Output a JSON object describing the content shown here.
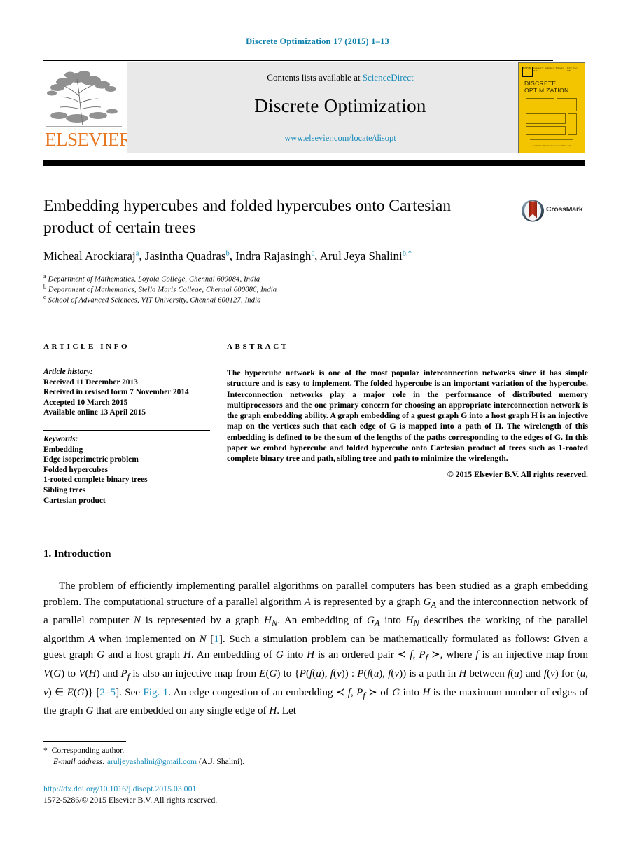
{
  "running_head": "Discrete Optimization 17 (2015) 1–13",
  "banner": {
    "publisher": "ELSEVIER",
    "contents_prefix": "Contents lists available at ",
    "contents_link": "ScienceDirect",
    "journal_name": "Discrete Optimization",
    "journal_url": "www.elsevier.com/locate/disopt",
    "cover": {
      "title_line1": "DISCRETE",
      "title_line2": "OPTIMIZATION",
      "top_left_mark": "ELSEVIER",
      "top_center_text": "Volume 17 · Number 1 · February 2015",
      "top_right_text": "ISSN 1572-5286",
      "footer_text": "Available online at www.sciencedirect.com"
    }
  },
  "article": {
    "title": "Embedding hypercubes and folded hypercubes onto Cartesian product of certain trees",
    "crossmark_label": "CrossMark",
    "authors_html": "Micheal Arockiaraj<sup>a</sup>, Jasintha Quadras<sup>b</sup>, Indra Rajasingh<sup>c</sup>, Arul Jeya Shalini<sup>b,*</sup>",
    "affiliations": [
      {
        "marker": "a",
        "text": "Department of Mathematics, Loyola College, Chennai 600084, India"
      },
      {
        "marker": "b",
        "text": "Department of Mathematics, Stella Maris College, Chennai 600086, India"
      },
      {
        "marker": "c",
        "text": "School of Advanced Sciences, VIT University, Chennai 600127, India"
      }
    ]
  },
  "info": {
    "heading": "ARTICLE INFO",
    "history_label": "Article history:",
    "history": [
      "Received 11 December 2013",
      "Received in revised form 7 November 2014",
      "Accepted 10 March 2015",
      "Available online 13 April 2015"
    ],
    "keywords_label": "Keywords:",
    "keywords": [
      "Embedding",
      "Edge isoperimetric problem",
      "Folded hypercubes",
      "1-rooted complete binary trees",
      "Sibling trees",
      "Cartesian product"
    ]
  },
  "abstract": {
    "heading": "ABSTRACT",
    "text": "The hypercube network is one of the most popular interconnection networks since it has simple structure and is easy to implement. The folded hypercube is an important variation of the hypercube. Interconnection networks play a major role in the performance of distributed memory multiprocessors and the one primary concern for choosing an appropriate interconnection network is the graph embedding ability. A graph embedding of a guest graph G into a host graph H is an injective map on the vertices such that each edge of G is mapped into a path of H. The wirelength of this embedding is defined to be the sum of the lengths of the paths corresponding to the edges of G. In this paper we embed hypercube and folded hypercube onto Cartesian product of trees such as 1-rooted complete binary tree and path, sibling tree and path to minimize the wirelength.",
    "copyright": "© 2015 Elsevier B.V. All rights reserved."
  },
  "body": {
    "section_number_title": "1. Introduction",
    "paragraph_html": "The problem of efficiently implementing parallel algorithms on parallel computers has been studied as a graph embedding problem. The computational structure of a parallel algorithm <i>A</i> is represented by a graph <i>G<sub>A</sub></i> and the interconnection network of a parallel computer <i>N</i> is represented by a graph <i>H<sub>N</sub></i>. An embedding of <i>G<sub>A</sub></i> into <i>H<sub>N</sub></i> describes the working of the parallel algorithm <i>A</i> when implemented on <i>N</i> [<span class=\"lnk\">1</span>]. Such a simulation problem can be mathematically formulated as follows: Given a guest graph <i>G</i> and a host graph <i>H</i>. An embedding of <i>G</i> into <i>H</i> is an ordered pair ≺ <i>f</i>, <i>P<sub>f</sub></i> ≻, where <i>f</i> is an injective map from <i>V</i>(<i>G</i>) to <i>V</i>(<i>H</i>) and <i>P<sub>f</sub></i> is also an injective map from <i>E</i>(<i>G</i>) to {<i>P</i>(<i>f</i>(<i>u</i>), <i>f</i>(<i>v</i>)) : <i>P</i>(<i>f</i>(<i>u</i>), <i>f</i>(<i>v</i>)) is a path in <i>H</i> between <i>f</i>(<i>u</i>) and <i>f</i>(<i>v</i>) for (<i>u</i>, <i>v</i>) ∈ <i>E</i>(<i>G</i>)} [<span class=\"lnk\">2–5</span>]. See <span class=\"lnk\">Fig. 1</span>. An edge congestion of an embedding ≺ <i>f</i>, <i>P<sub>f</sub></i> ≻ of <i>G</i> into <i>H</i> is the maximum number of edges of the graph <i>G</i> that are embedded on any single edge of <i>H</i>. Let"
  },
  "footer": {
    "corresponding_author": "Corresponding author.",
    "email_label": "E-mail address:",
    "email": "aruljeyashalini@gmail.com",
    "email_owner": "(A.J. Shalini).",
    "doi": "http://dx.doi.org/10.1016/j.disopt.2015.03.001",
    "issn_line": "1572-5286/© 2015 Elsevier B.V. All rights reserved."
  },
  "colors": {
    "link": "#1a8cba",
    "runhead": "#0b7faa",
    "elsevier_orange": "#e87722",
    "cover_yellow": "#f2c500"
  }
}
